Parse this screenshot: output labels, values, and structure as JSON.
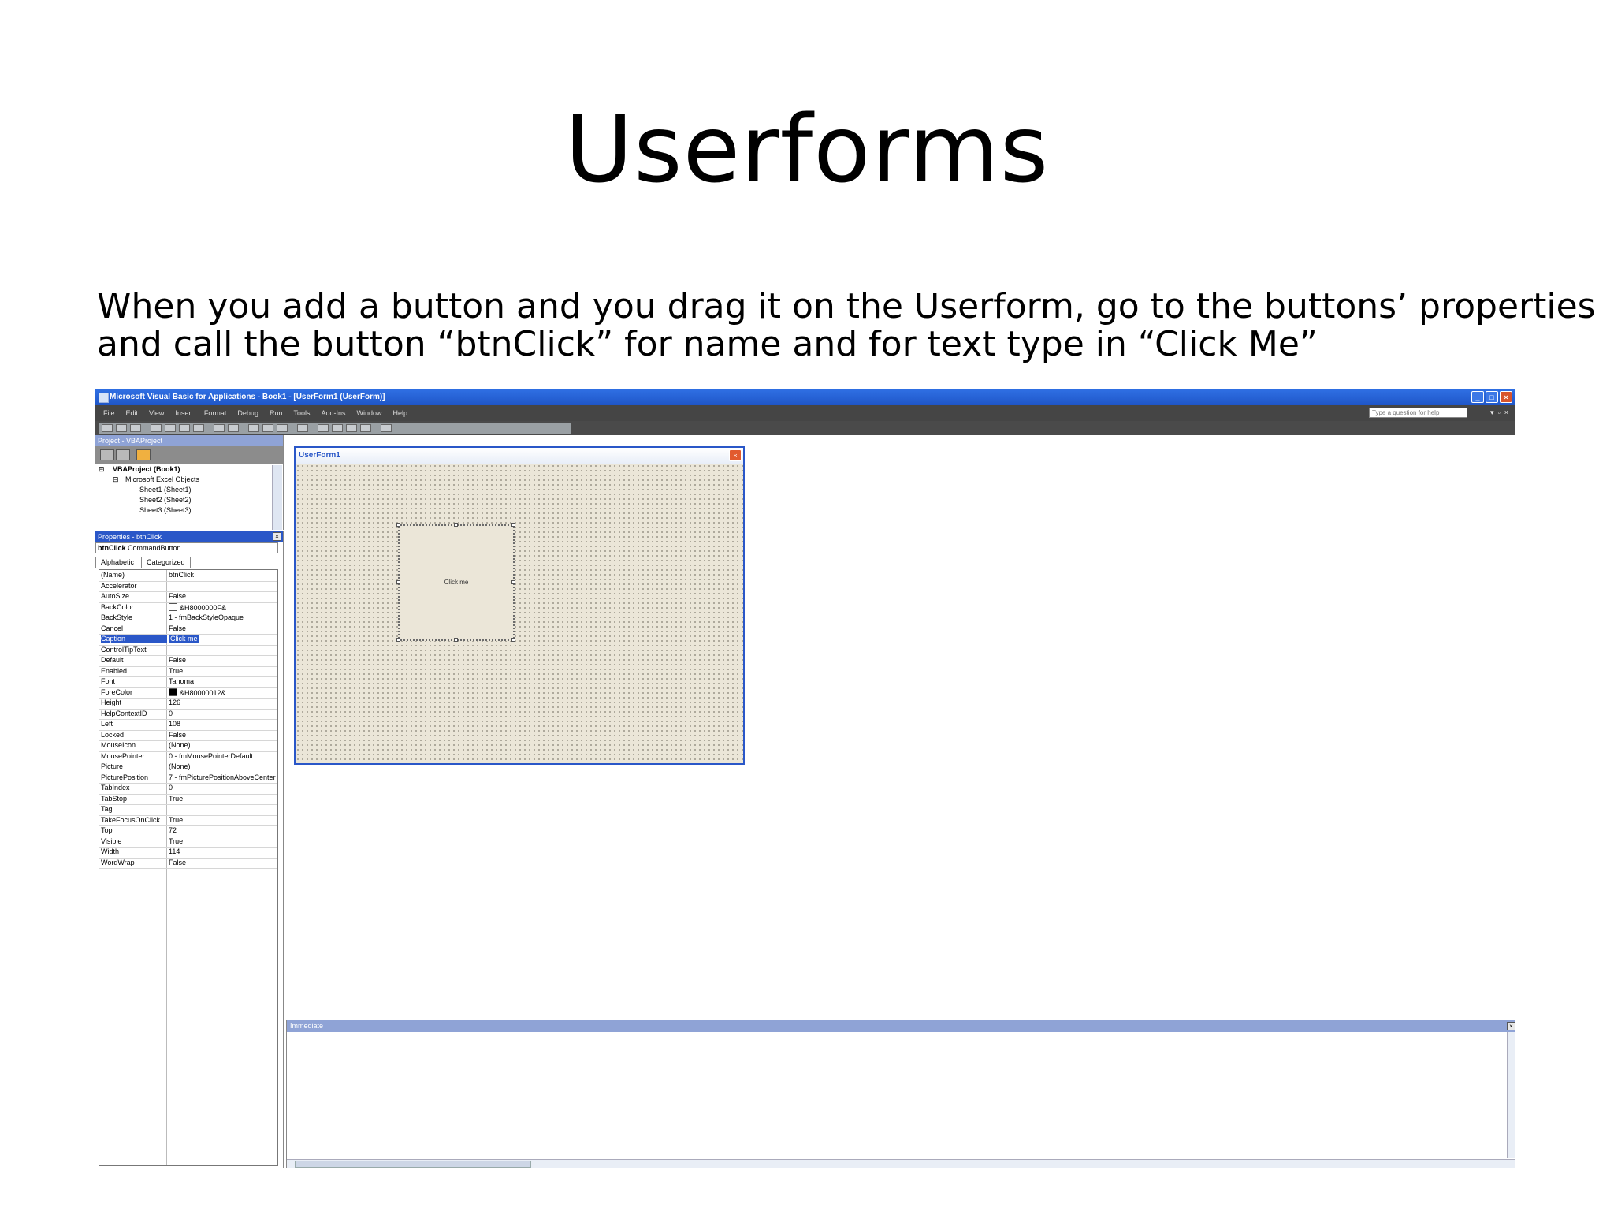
{
  "slide": {
    "title": "Userforms",
    "body_lines": [
      "When you add a button and you drag it on the Userform, go to the buttons’ properties",
      "and call the button “btnClick” for name and for text type in “Click Me”"
    ]
  },
  "vbe": {
    "window_title": "Microsoft Visual Basic for Applications - Book1 - [UserForm1 (UserForm)]",
    "window_buttons": [
      "_",
      "□",
      "×"
    ],
    "menus": [
      "File",
      "Edit",
      "View",
      "Insert",
      "Format",
      "Debug",
      "Run",
      "Tools",
      "Add-Ins",
      "Window",
      "Help"
    ],
    "help_placeholder": "Type a question for help",
    "project_panel": {
      "title": "Project - VBAProject",
      "tree": [
        "VBAProject (Book1)",
        "Microsoft Excel Objects",
        "Sheet1 (Sheet1)",
        "Sheet2 (Sheet2)",
        "Sheet3 (Sheet3)"
      ]
    },
    "properties_panel": {
      "title": "Properties - btnClick",
      "object_name": "btnClick",
      "object_type": "CommandButton",
      "tabs": [
        "Alphabetic",
        "Categorized"
      ],
      "rows": [
        {
          "name": "(Name)",
          "value": "btnClick"
        },
        {
          "name": "Accelerator",
          "value": ""
        },
        {
          "name": "AutoSize",
          "value": "False"
        },
        {
          "name": "BackColor",
          "value": "&H8000000F&"
        },
        {
          "name": "BackStyle",
          "value": "1 - fmBackStyleOpaque"
        },
        {
          "name": "Cancel",
          "value": "False"
        },
        {
          "name": "Caption",
          "value": "Click me"
        },
        {
          "name": "ControlTipText",
          "value": ""
        },
        {
          "name": "Default",
          "value": "False"
        },
        {
          "name": "Enabled",
          "value": "True"
        },
        {
          "name": "Font",
          "value": "Tahoma"
        },
        {
          "name": "ForeColor",
          "value": "&H80000012&"
        },
        {
          "name": "Height",
          "value": "126"
        },
        {
          "name": "HelpContextID",
          "value": "0"
        },
        {
          "name": "Left",
          "value": "108"
        },
        {
          "name": "Locked",
          "value": "False"
        },
        {
          "name": "MouseIcon",
          "value": "(None)"
        },
        {
          "name": "MousePointer",
          "value": "0 - fmMousePointerDefault"
        },
        {
          "name": "Picture",
          "value": "(None)"
        },
        {
          "name": "PicturePosition",
          "value": "7 - fmPicturePositionAboveCenter"
        },
        {
          "name": "TabIndex",
          "value": "0"
        },
        {
          "name": "TabStop",
          "value": "True"
        },
        {
          "name": "Tag",
          "value": ""
        },
        {
          "name": "TakeFocusOnClick",
          "value": "True"
        },
        {
          "name": "Top",
          "value": "72"
        },
        {
          "name": "Visible",
          "value": "True"
        },
        {
          "name": "Width",
          "value": "114"
        },
        {
          "name": "WordWrap",
          "value": "False"
        }
      ]
    },
    "userform": {
      "title": "UserForm1",
      "button_caption": "Click me"
    },
    "immediate_panel": {
      "title": "Immediate"
    },
    "colors": {
      "titlebar_blue": "#1f56c8",
      "form_grid_bg": "#ebe6d8",
      "selection_blue": "#2a57c8"
    }
  }
}
